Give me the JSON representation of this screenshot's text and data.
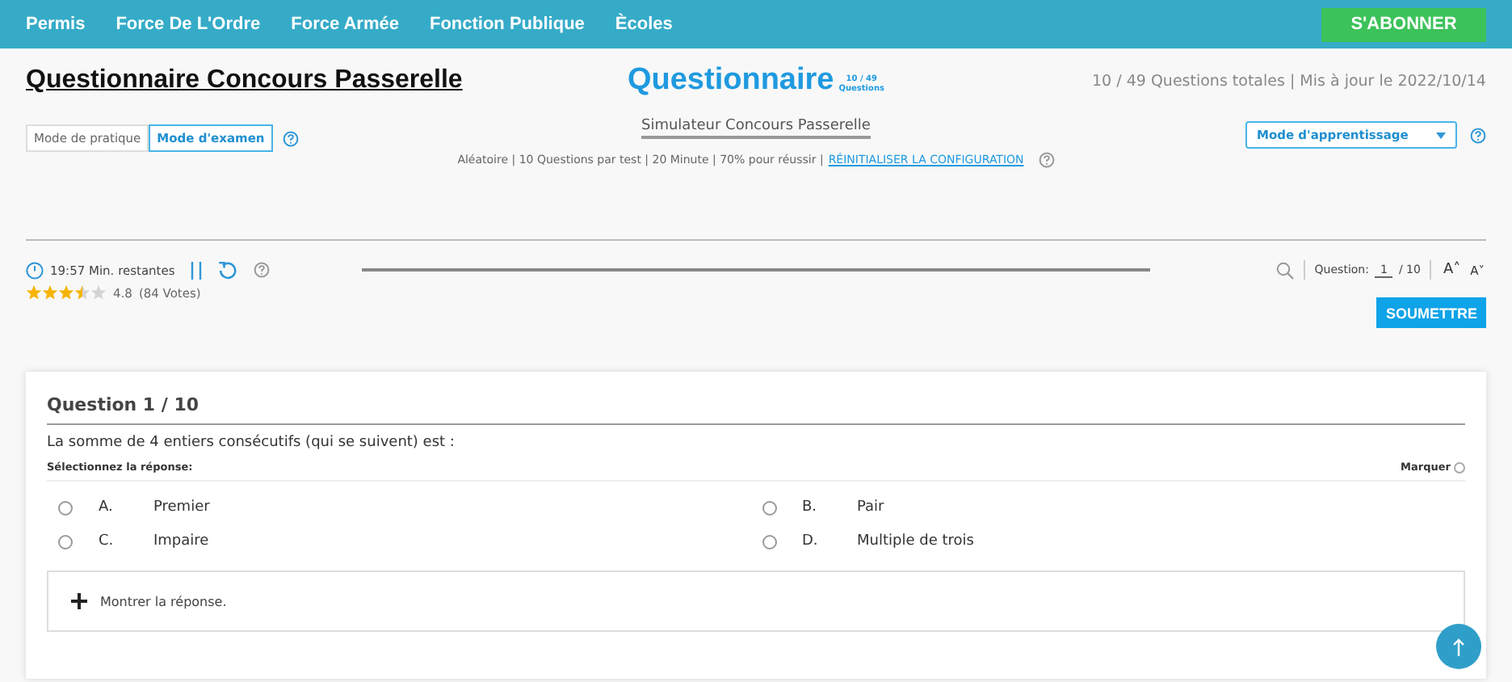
{
  "nav": {
    "items": [
      "Permis",
      "Force De L'Ordre",
      "Force Armée",
      "Fonction Publique",
      "Ècoles"
    ],
    "subscribe": "S'ABONNER"
  },
  "header": {
    "title": "Questionnaire Concours Passerelle",
    "brand": "Questionnaire",
    "brand_count": "10 / 49",
    "brand_sub": "Questions",
    "summary": "10 / 49 Questions totales | Mis à jour le 2022/10/14"
  },
  "modes": [
    {
      "label": "Mode de pratique",
      "selected": false
    },
    {
      "label": "Mode d'examen",
      "selected": true
    }
  ],
  "simulator": "Simulateur Concours Passerelle",
  "config": {
    "text": "Aléatoire | 10 Questions par test | 20 Minute | 70% pour réussir |",
    "link": "RÉINITIALISER LA CONFIGURATION"
  },
  "learning_select": "Mode d'apprentissage",
  "toolbar": {
    "timer": "19:57 Min. restantes",
    "question_label": "Question:",
    "question_value": "1",
    "question_total": "/ 10",
    "font_up": "A˄",
    "font_down": "A˅"
  },
  "rating": {
    "stars": 3.5,
    "score": "4.8",
    "votes": "(84 Votes)"
  },
  "submit": "SOUMETTRE",
  "question": {
    "heading": "Question 1 / 10",
    "text": "La somme de 4 entiers consécutifs (qui se suivent) est :",
    "select_label": "Sélectionnez la réponse:",
    "mark_label": "Marquer",
    "marked": false,
    "options": [
      {
        "letter": "A.",
        "text": "Premier",
        "selected": false
      },
      {
        "letter": "B.",
        "text": "Pair",
        "selected": false
      },
      {
        "letter": "C.",
        "text": "Impaire",
        "selected": false
      },
      {
        "letter": "D.",
        "text": "Multiple de trois",
        "selected": false
      }
    ],
    "show_answer": "Montrer la réponse."
  }
}
